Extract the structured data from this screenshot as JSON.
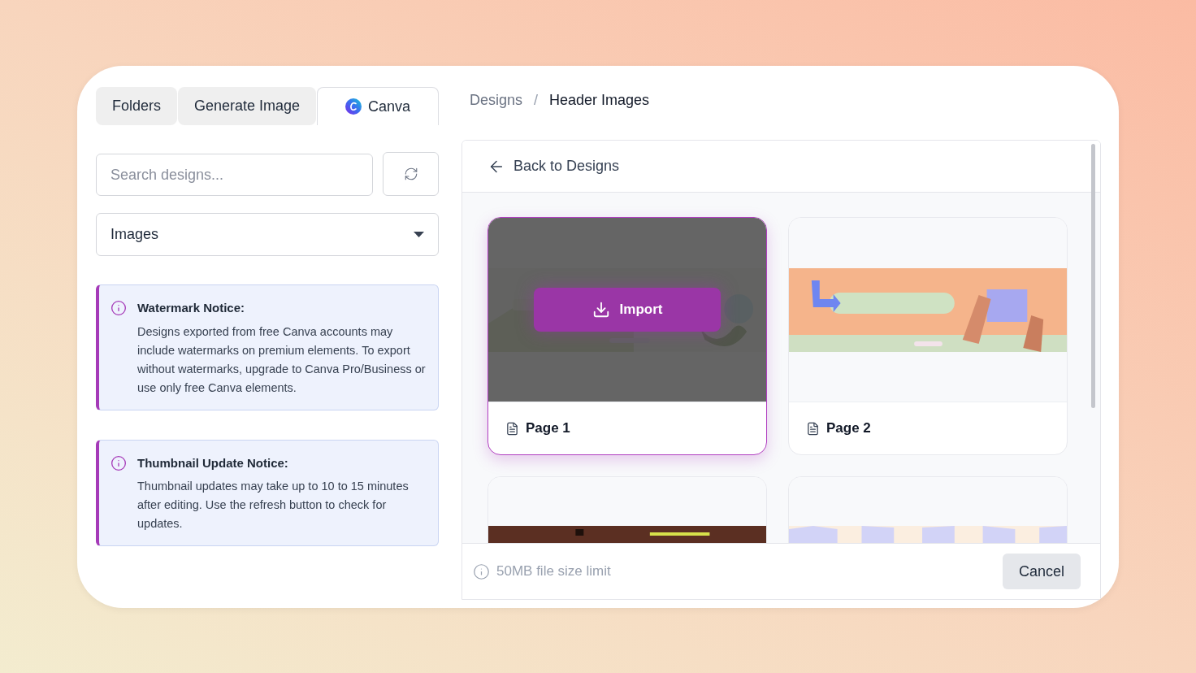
{
  "tabs": [
    {
      "label": "Folders",
      "selected": false,
      "kind": "plain"
    },
    {
      "label": "Generate Image",
      "selected": false,
      "kind": "plain"
    },
    {
      "label": "Canva",
      "selected": true,
      "kind": "canva"
    }
  ],
  "search": {
    "placeholder": "Search designs..."
  },
  "type_select": {
    "value": "Images"
  },
  "notices": [
    {
      "title": "Watermark Notice:",
      "body": "Designs exported from free Canva accounts may include watermarks on premium elements. To export without watermarks, upgrade to Canva Pro/Business or use only free Canva elements."
    },
    {
      "title": "Thumbnail Update Notice:",
      "body": "Thumbnail updates may take up to 10 to 15 minutes after editing. Use the refresh button to check for updates."
    }
  ],
  "breadcrumb": [
    {
      "label": "Designs",
      "selected": false
    },
    {
      "label": "Header Images",
      "selected": true
    }
  ],
  "breadcrumb_separator": "/",
  "back_link": "Back to Designs",
  "pages": [
    {
      "label": "Page 1",
      "selected": true,
      "kind": "picture",
      "import_button": "Import"
    },
    {
      "label": "Page 2",
      "selected": false,
      "kind": "picture"
    },
    {
      "selected": false,
      "kind": "picture"
    },
    {
      "selected": false,
      "kind": "picture"
    }
  ],
  "footer": {
    "limit_note": "50MB file size limit",
    "cancel_button": "Cancel"
  }
}
